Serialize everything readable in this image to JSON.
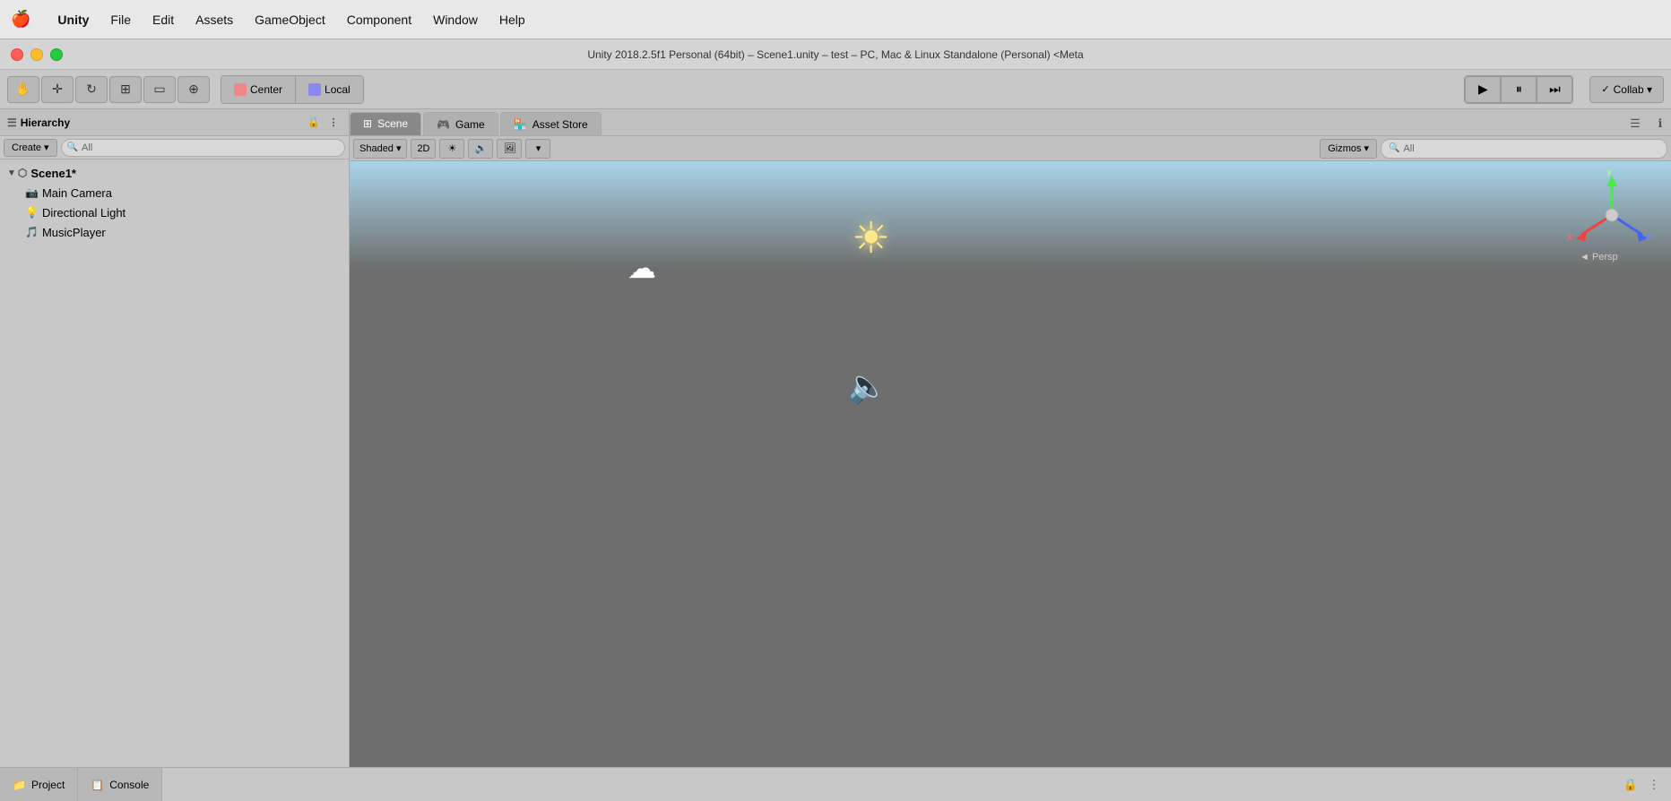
{
  "menubar": {
    "apple": "🍎",
    "items": [
      {
        "label": "Unity",
        "bold": true
      },
      {
        "label": "File"
      },
      {
        "label": "Edit"
      },
      {
        "label": "Assets"
      },
      {
        "label": "GameObject"
      },
      {
        "label": "Component"
      },
      {
        "label": "Window"
      },
      {
        "label": "Help"
      }
    ]
  },
  "titlebar": {
    "title": "Unity 2018.2.5f1 Personal (64bit) – Scene1.unity – test – PC, Mac & Linux Standalone (Personal) <Meta"
  },
  "toolbar": {
    "center_label": "Center",
    "local_label": "Local",
    "play_label": "▶",
    "pause_label": "⏸",
    "step_label": "⏭",
    "collab_label": "Collab ▾"
  },
  "hierarchy": {
    "title": "Hierarchy",
    "create_label": "Create",
    "create_arrow": "▾",
    "search_placeholder": "All",
    "scene_name": "Scene1*",
    "items": [
      {
        "label": "Main Camera",
        "icon": "📷",
        "indent": 1
      },
      {
        "label": "Directional Light",
        "icon": "💡",
        "indent": 1
      },
      {
        "label": "MusicPlayer",
        "icon": "🎵",
        "indent": 1
      }
    ]
  },
  "scene": {
    "tabs": [
      {
        "label": "Scene",
        "icon": "⊞",
        "active": true
      },
      {
        "label": "Game",
        "icon": "🎮",
        "active": false
      },
      {
        "label": "Asset Store",
        "icon": "🏪",
        "active": false
      }
    ],
    "shaded_label": "Shaded",
    "shaded_arrow": "▾",
    "twod_label": "2D",
    "gizmos_label": "Gizmos",
    "gizmos_arrow": "▾",
    "search_placeholder": "All",
    "gizmo": {
      "y_label": "y",
      "x_label": "x",
      "z_label": "z",
      "persp_label": "◄ Persp"
    }
  },
  "bottom": {
    "project_label": "Project",
    "console_label": "Console"
  },
  "icons": {
    "search": "🔍",
    "lock": "🔒",
    "menu": "☰",
    "sun": "☀",
    "cloud": "☁",
    "speaker": "🔈",
    "hand": "✋",
    "move": "✛",
    "rotate": "↻",
    "scale": "⊞",
    "rect": "▭",
    "transform": "⊕"
  }
}
